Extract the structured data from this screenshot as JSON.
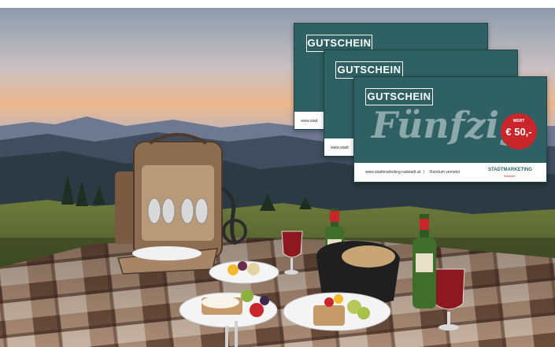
{
  "vouchers": [
    {
      "title": "GUTSCHEIN",
      "url": "www.stad"
    },
    {
      "title": "GUTSCHEIN",
      "url": "www.stadt"
    },
    {
      "title": "GUTSCHEIN",
      "script_text": "Fünfzig",
      "badge_top": "WERT",
      "badge_value": "€ 50,-",
      "footer_url": "www.stadtmarketing-radstadt.at",
      "footer_sep": "|",
      "footer_note": "Rundum vernetzt",
      "brand": "STADTMARKETING",
      "brand_sub": "Radstadt"
    }
  ],
  "colors": {
    "voucher": "#2f6164",
    "badge": "#c8262b",
    "sky_top": "#9aa6b4",
    "sky_glow": "#e9b48a",
    "blanket": "#8a6a55"
  },
  "icons": [
    "picnic-backpack-icon",
    "wine-bottle-icon",
    "wine-glass-icon",
    "bread-basket-icon",
    "plate-icon",
    "fork-icon",
    "knife-icon"
  ]
}
